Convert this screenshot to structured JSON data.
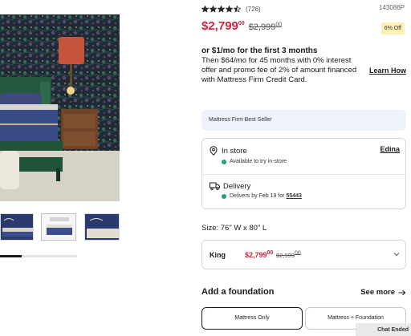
{
  "product": {
    "rating": 4.5,
    "review_count": "(726)",
    "sku": "143086P"
  },
  "price": {
    "sale_main": "$2,799",
    "sale_cents": "00",
    "original_main": "$2,999",
    "original_cents": "00",
    "discount": "6% Off"
  },
  "finance": {
    "title": "or $1/mo for the first 3 months",
    "body": "Then $64/mo for 45 months with 0% interest offer and promo fee of 2% of amount financed with Mattress Firm Credit Card.",
    "learn_more": "Learn How"
  },
  "best_seller": "Mattress Firm Best Seller",
  "availability": {
    "store_label": "In store",
    "store_name": "Edina",
    "store_status": "Available to try in-store",
    "delivery_label": "Delivery",
    "delivery_status_prefix": "Delivers by Feb 19 for",
    "zip": "55443"
  },
  "size": {
    "label": "Size: 76\" W x 80\" L",
    "selected_name": "King",
    "sale_main": "$2,799",
    "sale_cents": "00",
    "orig_main": "$2,999",
    "orig_cents": "00"
  },
  "foundation": {
    "title": "Add a foundation",
    "see_more": "See more",
    "options": [
      "Mattress Only",
      "Mattress + Foundation"
    ],
    "selected_index": 0
  },
  "gallery": {
    "scroll_progress": 0.28
  },
  "chat_status": "Chat Ended",
  "colors": {
    "sale_red": "#d6223b",
    "in_stock_green": "#22a473",
    "star_dark": "#2a2a2a",
    "badge_yellow": "#fcf1b4",
    "best_seller_bg": "#eef2fb"
  },
  "icons": {
    "star": "star-icon",
    "store": "location-pin-icon",
    "delivery": "truck-icon",
    "chevron": "chevron-down-icon",
    "arrow": "arrow-right-icon"
  }
}
